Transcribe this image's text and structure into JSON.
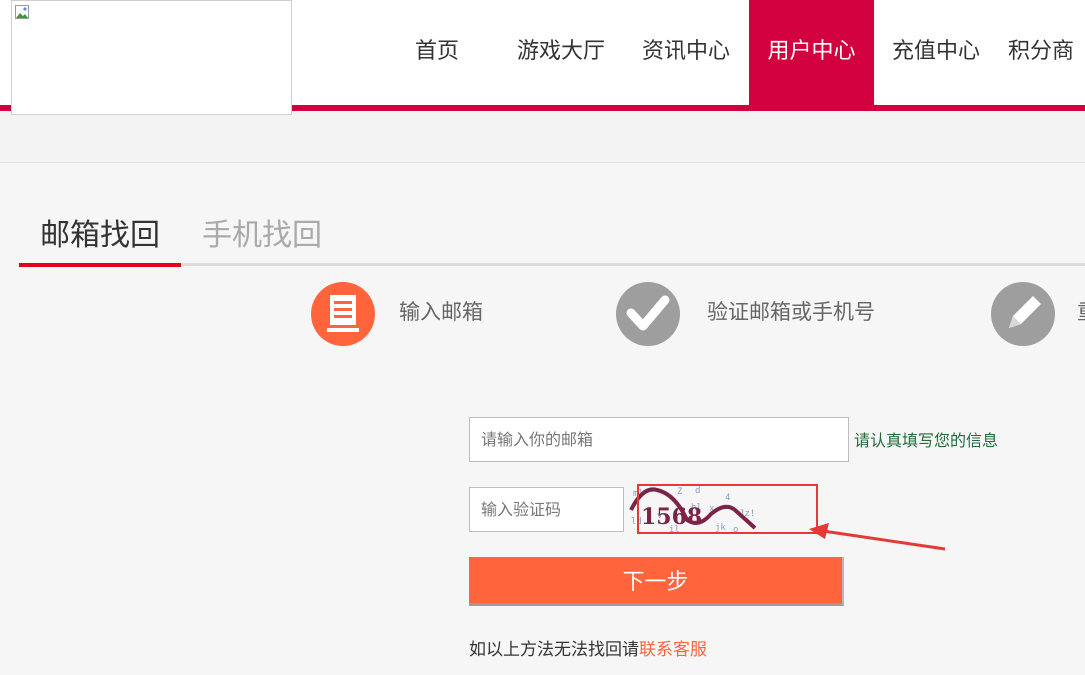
{
  "nav": {
    "items": [
      {
        "label": "首页",
        "active": false
      },
      {
        "label": "游戏大厅",
        "active": false
      },
      {
        "label": "资讯中心",
        "active": false
      },
      {
        "label": "用户中心",
        "active": true
      },
      {
        "label": "充值中心",
        "active": false
      },
      {
        "label": "积分商",
        "active": false
      }
    ]
  },
  "tabs": [
    {
      "label": "邮箱找回",
      "active": true
    },
    {
      "label": "手机找回",
      "active": false
    }
  ],
  "steps": [
    {
      "label": "输入邮箱",
      "icon": "edit-list-icon",
      "color": "#ff643d"
    },
    {
      "label": "验证邮箱或手机号",
      "icon": "check-icon",
      "color": "#9e9e9e"
    },
    {
      "label": "重",
      "icon": "pencil-icon",
      "color": "#9e9e9e"
    }
  ],
  "form": {
    "email_placeholder": "请输入你的邮箱",
    "email_hint": "请认真填写您的信息",
    "code_placeholder": "输入验证码",
    "captcha_text": "1568",
    "next_label": "下一步",
    "help_text": "如以上方法无法找回请",
    "contact_link": "联系客服"
  },
  "colors": {
    "brand_red": "#d3003f",
    "button_orange": "#ff643d",
    "hint_green": "#1f6b3a",
    "annotation_red": "#e53935"
  }
}
